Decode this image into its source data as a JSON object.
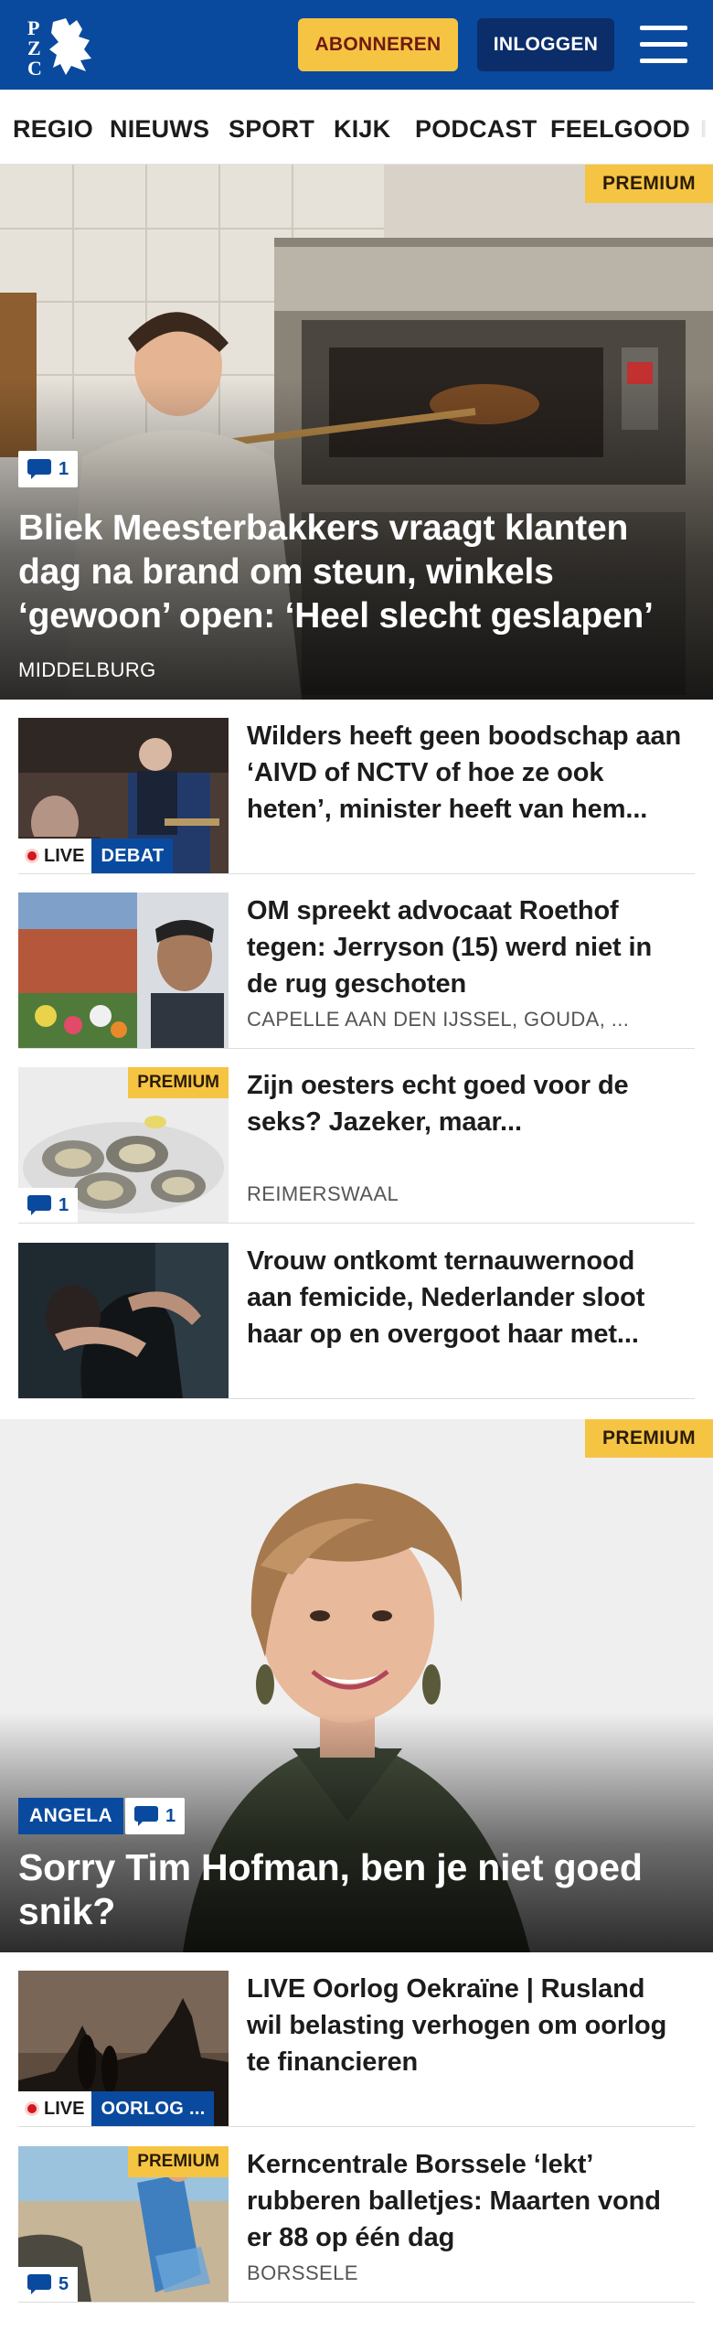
{
  "header": {
    "logo_text": "PZC",
    "subscribe_label": "ABONNEREN",
    "login_label": "INLOGGEN",
    "colors": {
      "brand": "#0a4a9e",
      "accent": "#f6c443"
    }
  },
  "nav": {
    "items": [
      "REGIO",
      "NIEUWS",
      "SPORT",
      "KIJK",
      "PODCAST",
      "FEELGOOD",
      "I"
    ]
  },
  "hero1": {
    "premium": "PREMIUM",
    "comments": "1",
    "title": "Bliek Meesterbakkers vraagt klanten dag na brand om steun, winkels ‘gewoon’ open: ‘Heel slecht geslapen’",
    "location": "MIDDELBURG"
  },
  "articles": [
    {
      "title": "Wilders heeft geen boodschap aan ‘AIVD of NCTV of hoe ze ook heten’, minister heeft van hem...",
      "live": "LIVE",
      "category": "DEBAT"
    },
    {
      "title": "OM spreekt advocaat Roethof tegen: Jerryson (15) werd niet in de rug geschoten",
      "location": "CAPELLE AAN DEN IJSSEL, GOUDA, ..."
    },
    {
      "title": "Zijn oesters echt goed voor de seks? Jazeker, maar...",
      "location": "REIMERSWAAL",
      "premium": "PREMIUM",
      "comments": "1"
    },
    {
      "title": "Vrouw ontkomt ternauwernood aan femicide, Nederlander sloot haar op en overgoot haar met..."
    }
  ],
  "hero2": {
    "premium": "PREMIUM",
    "label": "ANGELA",
    "comments": "1",
    "title": "Sorry Tim Hofman, ben je niet goed snik?"
  },
  "articles2": [
    {
      "title": "LIVE Oorlog Oekraïne | Rusland wil belasting verhogen om oorlog te financieren",
      "live": "LIVE",
      "category": "OORLOG ..."
    },
    {
      "title": "Kerncentrale Borssele ‘lekt’ rubberen balletjes: Maarten vond er 88 op één dag",
      "location": "BORSSELE",
      "premium": "PREMIUM",
      "comments": "5"
    }
  ]
}
